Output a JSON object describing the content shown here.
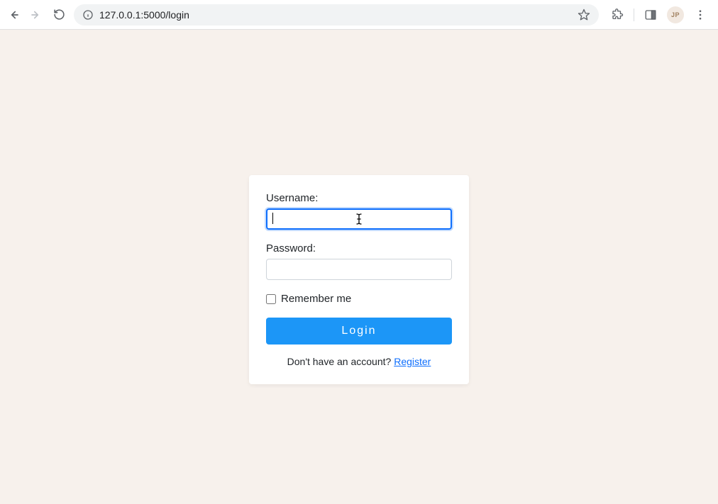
{
  "browser": {
    "url": "127.0.0.1:5000/login",
    "profile_initials": "JP"
  },
  "form": {
    "username_label": "Username:",
    "password_label": "Password:",
    "remember_label": "Remember me",
    "login_button": "Login",
    "register_prompt": "Don't have an account? ",
    "register_link": "Register"
  }
}
